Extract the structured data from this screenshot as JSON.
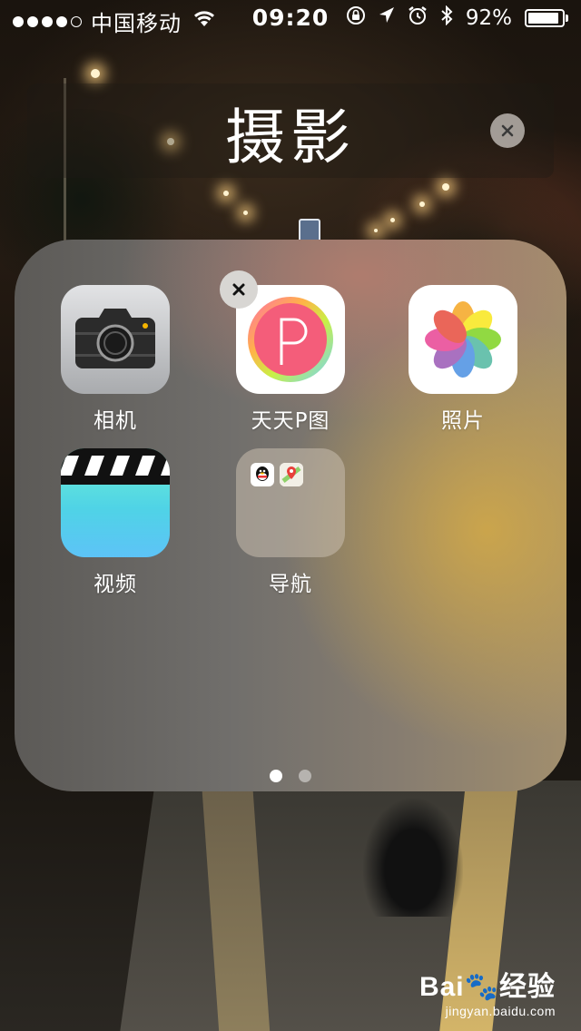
{
  "status_bar": {
    "carrier": "中国移动",
    "time": "09:20",
    "battery_percent_label": "92%",
    "battery_level": 0.92
  },
  "folder": {
    "title": "摄影",
    "apps": [
      {
        "label": "相机",
        "icon": "camera-icon"
      },
      {
        "label": "天天P图",
        "icon": "p-letter-icon",
        "deletable": true
      },
      {
        "label": "照片",
        "icon": "photos-flower-icon"
      },
      {
        "label": "视频",
        "icon": "clapperboard-icon"
      },
      {
        "label": "导航",
        "icon": "folder-icon",
        "contains": [
          "qq-icon",
          "baidu-map-icon"
        ]
      }
    ],
    "pages": 2,
    "current_page": 1
  },
  "watermark": {
    "brand": "Bai🐾经验",
    "url": "jingyan.baidu.com"
  },
  "colors": {
    "p_app_pink": "#f45d7a",
    "video_teal": "#5fe0dc"
  }
}
